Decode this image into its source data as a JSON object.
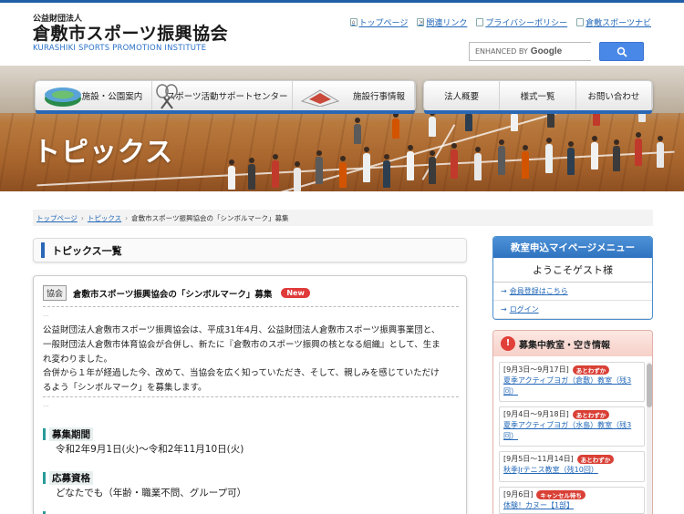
{
  "site": {
    "sub": "公益財団法人",
    "name": "倉敷市スポーツ振興協会",
    "name_en": "KURASHIKI SPORTS PROMOTION INSTITUTE"
  },
  "header_links": [
    {
      "label": "トップページ",
      "icon": "home-icon"
    },
    {
      "label": "関連リンク",
      "icon": "link-icon"
    },
    {
      "label": "プライバシーポリシー",
      "icon": "page-icon"
    },
    {
      "label": "倉敷スポーツナビ",
      "icon": "page-icon"
    }
  ],
  "search": {
    "placeholder": "ENHANCED BY",
    "brand": "Google",
    "button_icon": "search-icon"
  },
  "nav_main": [
    {
      "label": "施設・公園案内",
      "icon": "stadium-icon"
    },
    {
      "label": "スポーツ活動サポートセンター",
      "icon": "rackets-icon"
    },
    {
      "label": "施設行事情報",
      "icon": "building-icon"
    }
  ],
  "nav_sub": [
    "法人概要",
    "様式一覧",
    "お問い合わせ"
  ],
  "hero": {
    "title": "トピックス"
  },
  "breadcrumb": {
    "home": "トップページ",
    "section": "トピックス",
    "current": "倉敷市スポーツ振興協会の「シンボルマーク」募集"
  },
  "main": {
    "heading": "トピックス一覧",
    "article": {
      "tag": "協会",
      "title": "倉敷市スポーツ振興協会の「シンボルマーク」募集",
      "new_badge": "New",
      "body": [
        "公益財団法人倉敷市スポーツ振興協会は、平成31年4月、公益財団法人倉敷市スポーツ振興事業団と、",
        "一般財団法人倉敷市体育協会が合併し、新たに『倉敷市のスポーツ振興の核となる組織』として、生ま",
        "れ変わりました。",
        "合併から１年が経過した今、改めて、当協会を広く知っていただき、そして、親しみを感じていただけ",
        "るよう「シンボルマーク」を募集します。"
      ],
      "sections": [
        {
          "label": "募集期間",
          "value": "令和2年9月1日(火)〜令和2年11月10日(火)"
        },
        {
          "label": "応募資格",
          "value": "どなたでも（年齢・職業不問、グループ可）"
        }
      ]
    }
  },
  "sidebar": {
    "mypage": {
      "title": "教室申込マイページメニュー",
      "welcome": "ようこそゲスト様",
      "links": [
        "会員登録はこちら",
        "ログイン"
      ]
    },
    "classes": {
      "title": "募集中教室・空き情報",
      "icon_text": "!",
      "items": [
        {
          "date": "[9月3日〜9月17日]",
          "badge": "あとわずか",
          "title": "夏季アクティブヨガ（倉敷）教室（残3回）"
        },
        {
          "date": "[9月4日〜9月18日]",
          "badge": "あとわずか",
          "title": "夏季アクティブヨガ（水島）教室（残3回）"
        },
        {
          "date": "[9月5日〜11月14日]",
          "badge": "あとわずか",
          "title": "秋季Jrテニス教室（残10回）"
        },
        {
          "date": "[9月6日]",
          "badge": "キャンセル待ち",
          "title": "体験！カヌー【1部】"
        }
      ]
    }
  }
}
